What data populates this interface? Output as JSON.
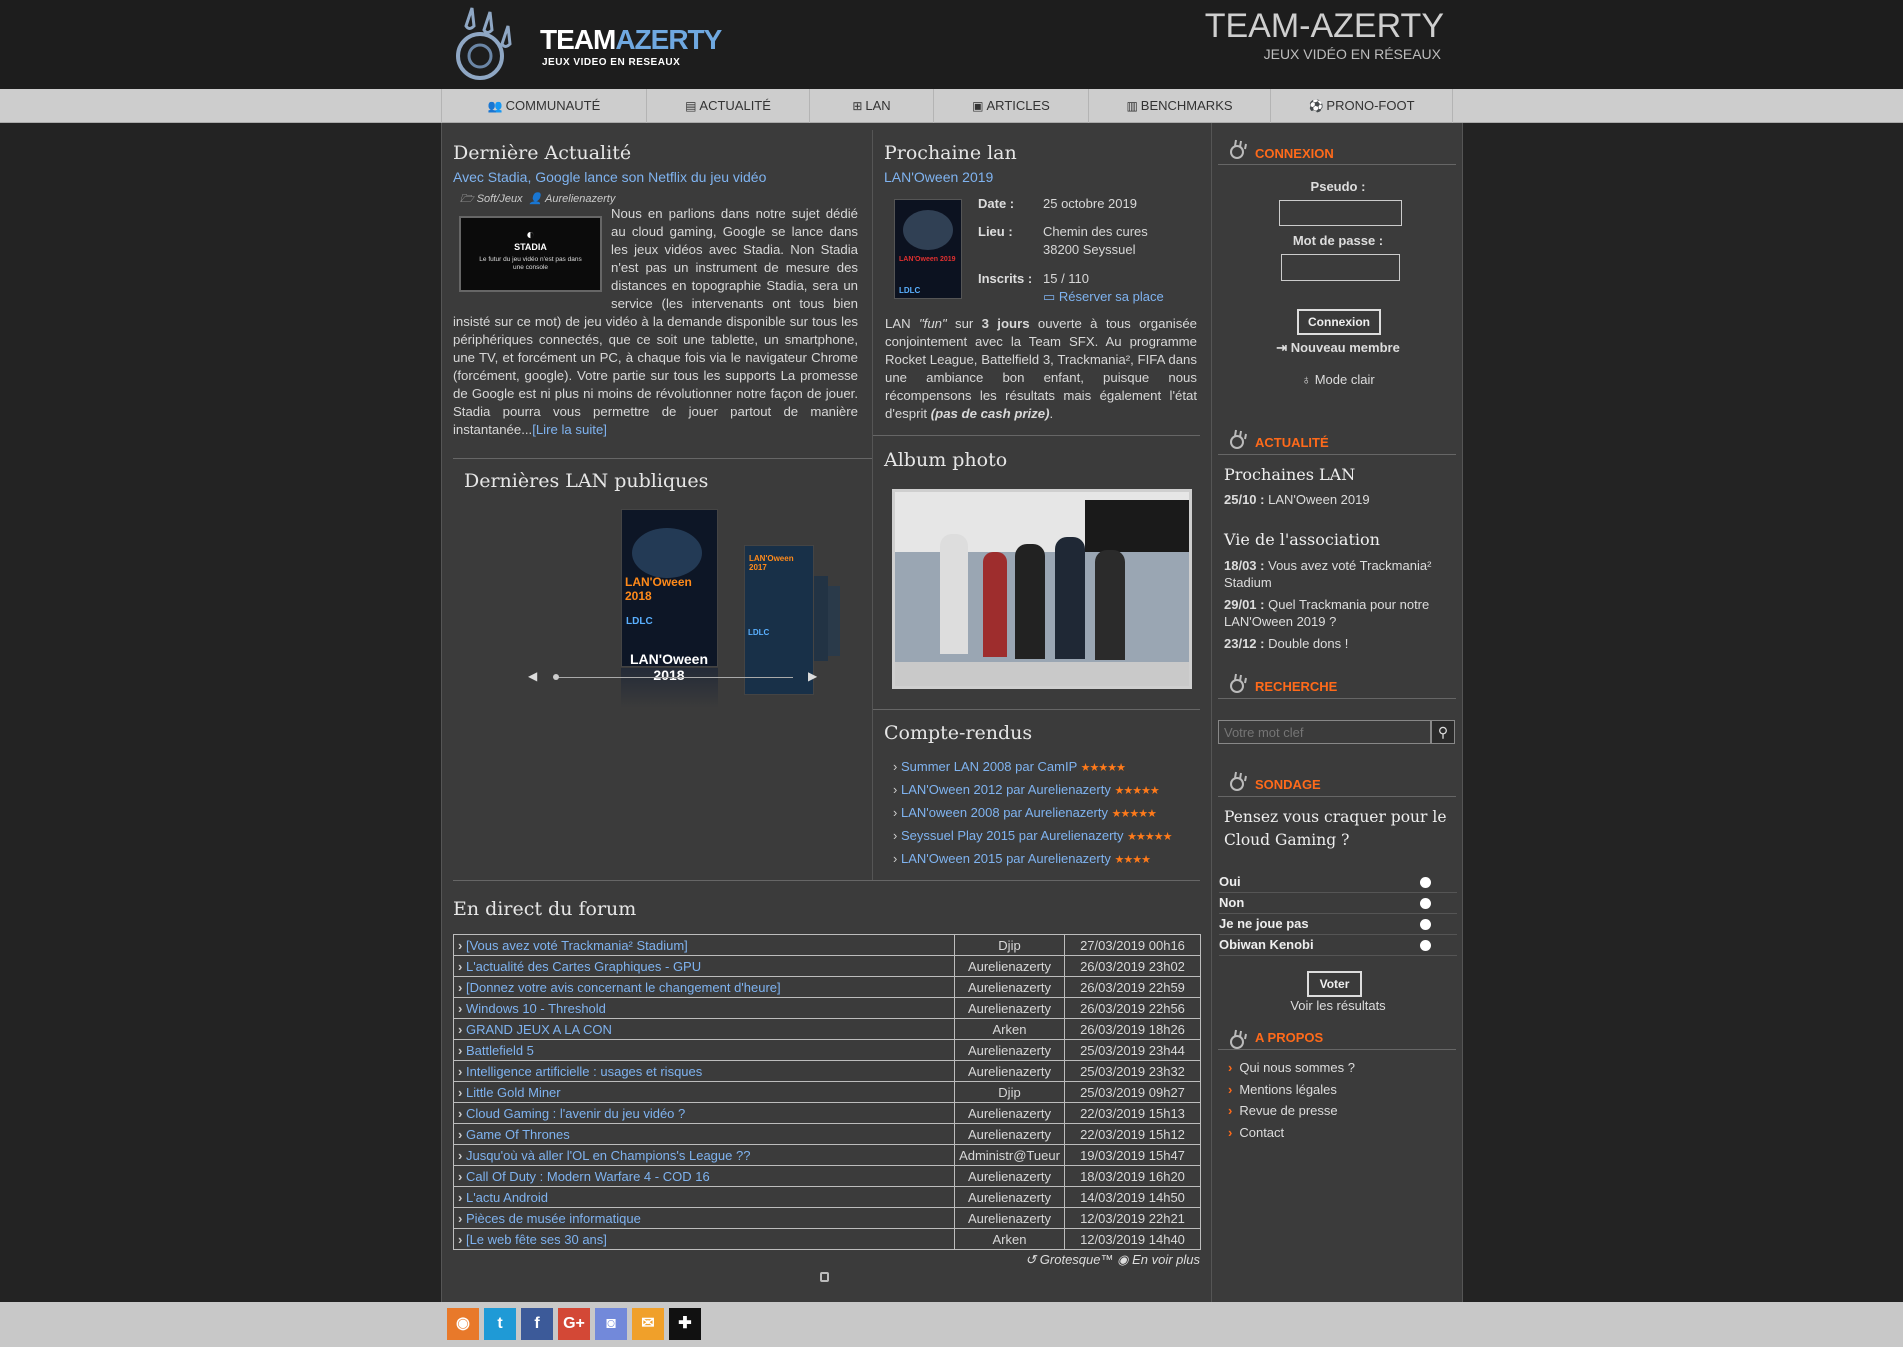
{
  "header": {
    "logo_main": "TEAM",
    "logo_accent": "AZERTY",
    "logo_tagline": "JEUX VIDEO EN RESEAUX",
    "site_title": "TEAM-AZERTY",
    "site_subtitle": "JEUX VIDÉO EN RÉSEAUX"
  },
  "nav": [
    {
      "label": "COMMUNAUTÉ",
      "icon": "users-icon"
    },
    {
      "label": "ACTUALITÉ",
      "icon": "newspaper-icon"
    },
    {
      "label": "LAN",
      "icon": "sitemap-icon"
    },
    {
      "label": "ARTICLES",
      "icon": "archive-icon"
    },
    {
      "label": "BENCHMARKS",
      "icon": "chart-icon"
    },
    {
      "label": "PRONO-FOOT",
      "icon": "football-icon"
    }
  ],
  "news": {
    "heading": "Dernière Actualité",
    "title": "Avec Stadia, Google lance son Netflix du jeu vidéo",
    "category": "Soft/Jeux",
    "author": "Aurelienazerty",
    "thumb_brand": "STADIA",
    "thumb_caption": "Le futur du jeu vidéo n'est pas dans une console",
    "body": "Nous en parlions dans notre sujet dédié au cloud gaming, Google se lance dans les jeux vidéos avec Stadia. Non Stadia n'est pas un instrument de mesure des distances en topographie Stadia, sera un service (les intervenants ont tous bien insisté sur ce mot) de jeu vidéo à la demande disponible sur tous les périphériques connectés, que ce soit une tablette, un smartphone, une TV, et forcément un PC, à chaque fois via le navigateur Chrome (forcément, google). Votre partie sur tous les supports La promesse de Google est ni plus ni moins de révolutionner notre façon de jouer. Stadia pourra vous permettre de jouer partout de manière instantanée...",
    "read_more": "[Lire la suite]"
  },
  "next_lan": {
    "heading": "Prochaine lan",
    "name": "LAN'Oween 2019",
    "date_label": "Date :",
    "date": "25 octobre 2019",
    "place_label": "Lieu :",
    "place_line1": "Chemin des cures",
    "place_line2": "38200 Seyssuel",
    "registered_label": "Inscrits :",
    "registered": "15 / 110",
    "reserve": "Réserver sa place",
    "desc_1": "LAN ",
    "desc_fun": "\"fun\"",
    "desc_2": " sur ",
    "desc_days": "3 jours",
    "desc_3": " ouverte à tous organisée conjointement avec la Team SFX. Au programme Rocket League, Battelfield 3, Trackmania², FIFA dans une ambiance bon enfant, puisque nous récompensons les résultats mais également l'état d'esprit ",
    "desc_prize": "(pas de cash prize)",
    "desc_4": "."
  },
  "public_lans": {
    "heading": "Dernières LAN publiques",
    "caption": "LAN'Oween 2018",
    "poster_main": "LAN'Oween 2018",
    "poster_second": "LAN'Oween 2017"
  },
  "album": {
    "heading": "Album photo"
  },
  "reports": {
    "heading": "Compte-rendus",
    "items": [
      {
        "label": "Summer LAN 2008 par CamIP",
        "stars": "★★★★★"
      },
      {
        "label": "LAN'Oween 2012 par Aurelienazerty",
        "stars": "★★★★★"
      },
      {
        "label": "LAN'oween 2008 par Aurelienazerty",
        "stars": "★★★★★"
      },
      {
        "label": "Seyssuel Play 2015 par Aurelienazerty",
        "stars": "★★★★★"
      },
      {
        "label": "LAN'Oween 2015 par Aurelienazerty",
        "stars": "★★★★"
      }
    ]
  },
  "forum": {
    "heading": "En direct du forum",
    "rows": [
      {
        "title": "[Vous avez voté Trackmania² Stadium]",
        "user": "Djip",
        "date": "27/03/2019 00h16"
      },
      {
        "title": "L'actualité des Cartes Graphiques - GPU",
        "user": "Aurelienazerty",
        "date": "26/03/2019 23h02"
      },
      {
        "title": "[Donnez votre avis concernant le changement d'heure]",
        "user": "Aurelienazerty",
        "date": "26/03/2019 22h59"
      },
      {
        "title": "Windows 10 - Threshold",
        "user": "Aurelienazerty",
        "date": "26/03/2019 22h56"
      },
      {
        "title": "GRAND JEUX A LA CON",
        "user": "Arken",
        "date": "26/03/2019 18h26"
      },
      {
        "title": "Battlefield 5",
        "user": "Aurelienazerty",
        "date": "25/03/2019 23h44"
      },
      {
        "title": "Intelligence artificielle : usages et risques",
        "user": "Aurelienazerty",
        "date": "25/03/2019 23h32"
      },
      {
        "title": "Little Gold Miner",
        "user": "Djip",
        "date": "25/03/2019 09h27"
      },
      {
        "title": "Cloud Gaming : l'avenir du jeu vidéo ?",
        "user": "Aurelienazerty",
        "date": "22/03/2019 15h13"
      },
      {
        "title": "Game Of Thrones",
        "user": "Aurelienazerty",
        "date": "22/03/2019 15h12"
      },
      {
        "title": "Jusqu'où và aller l'OL en Champions's League ??",
        "user": "Administr@Tueur",
        "date": "19/03/2019 15h47"
      },
      {
        "title": "Call Of Duty : Modern Warfare 4 - COD 16",
        "user": "Aurelienazerty",
        "date": "18/03/2019 16h20"
      },
      {
        "title": "L'actu Android",
        "user": "Aurelienazerty",
        "date": "14/03/2019 14h50"
      },
      {
        "title": "Pièces de musée informatique",
        "user": "Aurelienazerty",
        "date": "12/03/2019 22h21"
      },
      {
        "title": "[Le web fête ses 30 ans]",
        "user": "Arken",
        "date": "12/03/2019 14h40"
      }
    ],
    "grotesque": "Grotesque™",
    "see_more": "En voir plus"
  },
  "sidebar": {
    "login": {
      "heading": "CONNEXION",
      "pseudo_label": "Pseudo :",
      "password_label": "Mot de passe :",
      "button": "Connexion",
      "new_member": "Nouveau membre",
      "light_mode": "Mode clair"
    },
    "news": {
      "heading": "ACTUALITÉ",
      "next_lan_title": "Prochaines LAN",
      "next_lan_date": "25/10 :",
      "next_lan_name": "LAN'Oween 2019",
      "assoc_title": "Vie de l'association",
      "assoc_items": [
        {
          "date": "18/03 :",
          "text": "Vous avez voté Trackmania² Stadium"
        },
        {
          "date": "29/01 :",
          "text": "Quel Trackmania pour notre LAN'Oween 2019 ?"
        },
        {
          "date": "23/12 :",
          "text": "Double dons !"
        }
      ]
    },
    "search": {
      "heading": "RECHERCHE",
      "placeholder": "Votre mot clef"
    },
    "poll": {
      "heading": "SONDAGE",
      "question": "Pensez vous craquer pour le Cloud Gaming ?",
      "options": [
        "Oui",
        "Non",
        "Je ne joue pas",
        "Obiwan Kenobi"
      ],
      "vote": "Voter",
      "results": "Voir les résultats"
    },
    "about": {
      "heading": "A PROPOS",
      "links": [
        "Qui nous sommes ?",
        "Mentions légales",
        "Revue de presse",
        "Contact"
      ]
    }
  },
  "social": [
    {
      "name": "rss-icon",
      "glyph": "◉",
      "color": "#e8792a"
    },
    {
      "name": "twitter-icon",
      "glyph": "t",
      "color": "#1f9ad6"
    },
    {
      "name": "facebook-icon",
      "glyph": "f",
      "color": "#3c5a99"
    },
    {
      "name": "google-plus-icon",
      "glyph": "G+",
      "color": "#d34836"
    },
    {
      "name": "discord-icon",
      "glyph": "◙",
      "color": "#7289da"
    },
    {
      "name": "chat-icon",
      "glyph": "✉",
      "color": "#f0a02a"
    },
    {
      "name": "gift-icon",
      "glyph": "✚",
      "color": "#111111"
    }
  ]
}
